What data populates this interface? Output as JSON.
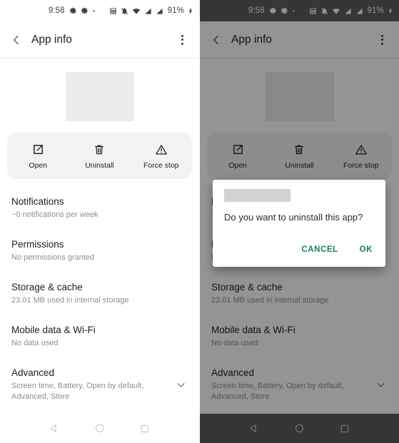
{
  "status_bar": {
    "time": "9:58",
    "battery": "91%",
    "icons": [
      "settings-gear-icon",
      "settings-gear-icon",
      "dot-icon",
      "calculator-icon",
      "notifications-muted-icon",
      "wifi-icon",
      "signal-icon",
      "signal-icon",
      "charging-bolt-icon"
    ]
  },
  "app_bar": {
    "title": "App info",
    "back_icon": "back-chevron-icon",
    "menu_icon": "overflow-menu-icon"
  },
  "app_header": {
    "icon_placeholder": "redacted-app-icon"
  },
  "actions": [
    {
      "label": "Open",
      "icon": "open-external-icon"
    },
    {
      "label": "Uninstall",
      "icon": "trash-icon"
    },
    {
      "label": "Force stop",
      "icon": "warning-triangle-icon"
    }
  ],
  "settings_list": [
    {
      "title": "Notifications",
      "subtitle": "~0 notifications per week",
      "expander": false
    },
    {
      "title": "Permissions",
      "subtitle": "No permissions granted",
      "expander": false
    },
    {
      "title": "Storage & cache",
      "subtitle": "23.01 MB used in internal storage",
      "expander": false
    },
    {
      "title": "Mobile data & Wi-Fi",
      "subtitle": "No data used",
      "expander": false
    },
    {
      "title": "Advanced",
      "subtitle": "Screen time, Battery, Open by default, Advanced, Store",
      "expander": true
    }
  ],
  "dialog": {
    "title_redacted": true,
    "message": "Do you want to uninstall this app?",
    "cancel_label": "CANCEL",
    "ok_label": "OK",
    "accent_color": "#1a7a6a"
  },
  "nav_bar": {
    "back": "nav-back-icon",
    "home": "nav-home-icon",
    "recents": "nav-recents-icon"
  },
  "colors": {
    "accent": "#1a7a6a",
    "card": "#f1f2f4",
    "redact_light": "#ebecee",
    "redact_dark": "#d2d2d2",
    "scrim": "rgba(0,0,0,0.42)"
  }
}
